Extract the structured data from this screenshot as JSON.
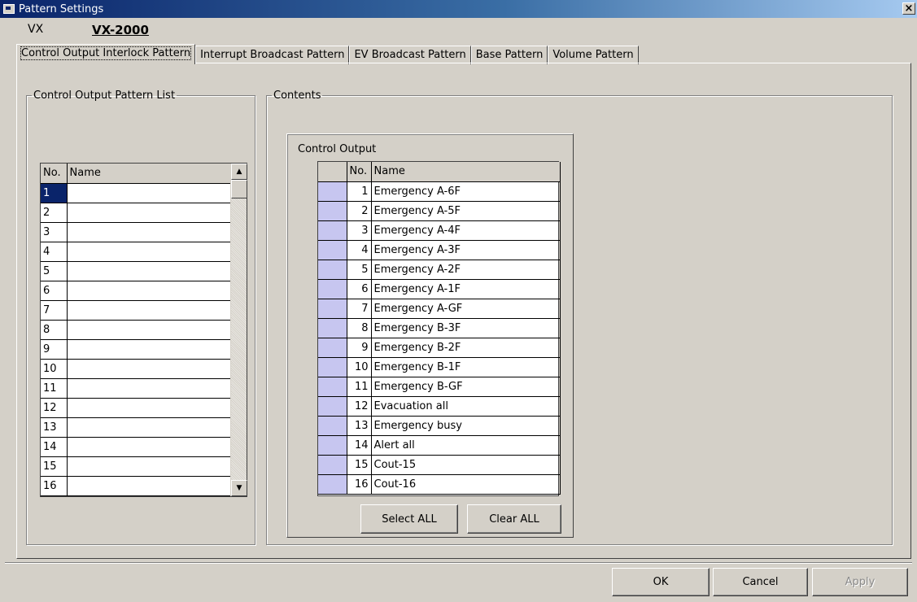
{
  "window": {
    "title": "Pattern Settings"
  },
  "device": {
    "label": "VX",
    "model": "VX-2000"
  },
  "tabs": [
    {
      "label": "Control Output Interlock Pattern"
    },
    {
      "label": "Interrupt Broadcast Pattern"
    },
    {
      "label": "EV Broadcast Pattern"
    },
    {
      "label": "Base Pattern"
    },
    {
      "label": "Volume Pattern"
    }
  ],
  "pattern_list": {
    "group_label": "Control Output Pattern List",
    "col_no": "No.",
    "col_name": "Name",
    "rows": [
      "1",
      "2",
      "3",
      "4",
      "5",
      "6",
      "7",
      "8",
      "9",
      "10",
      "11",
      "12",
      "13",
      "14",
      "15",
      "16"
    ],
    "selected_row": "1"
  },
  "contents": {
    "group_label": "Contents",
    "control_output": {
      "group_label": "Control Output",
      "col_no": "No.",
      "col_name": "Name",
      "rows": [
        {
          "no": "1",
          "name": "Emergency A-6F"
        },
        {
          "no": "2",
          "name": "Emergency A-5F"
        },
        {
          "no": "3",
          "name": "Emergency A-4F"
        },
        {
          "no": "4",
          "name": "Emergency A-3F"
        },
        {
          "no": "5",
          "name": "Emergency A-2F"
        },
        {
          "no": "6",
          "name": "Emergency A-1F"
        },
        {
          "no": "7",
          "name": "Emergency A-GF"
        },
        {
          "no": "8",
          "name": "Emergency B-3F"
        },
        {
          "no": "9",
          "name": "Emergency B-2F"
        },
        {
          "no": "10",
          "name": "Emergency B-1F"
        },
        {
          "no": "11",
          "name": "Emergency B-GF"
        },
        {
          "no": "12",
          "name": "Evacuation all"
        },
        {
          "no": "13",
          "name": "Emergency busy"
        },
        {
          "no": "14",
          "name": "Alert all"
        },
        {
          "no": "15",
          "name": "Cout-15"
        },
        {
          "no": "16",
          "name": "Cout-16"
        }
      ],
      "select_all_label": "Select ALL",
      "clear_all_label": "Clear ALL"
    }
  },
  "footer": {
    "ok_label": "OK",
    "cancel_label": "Cancel",
    "apply_label": "Apply"
  },
  "colors": {
    "selection": "#0a246a",
    "check_cell": "#c7c6f0",
    "face": "#d4d0c8"
  }
}
